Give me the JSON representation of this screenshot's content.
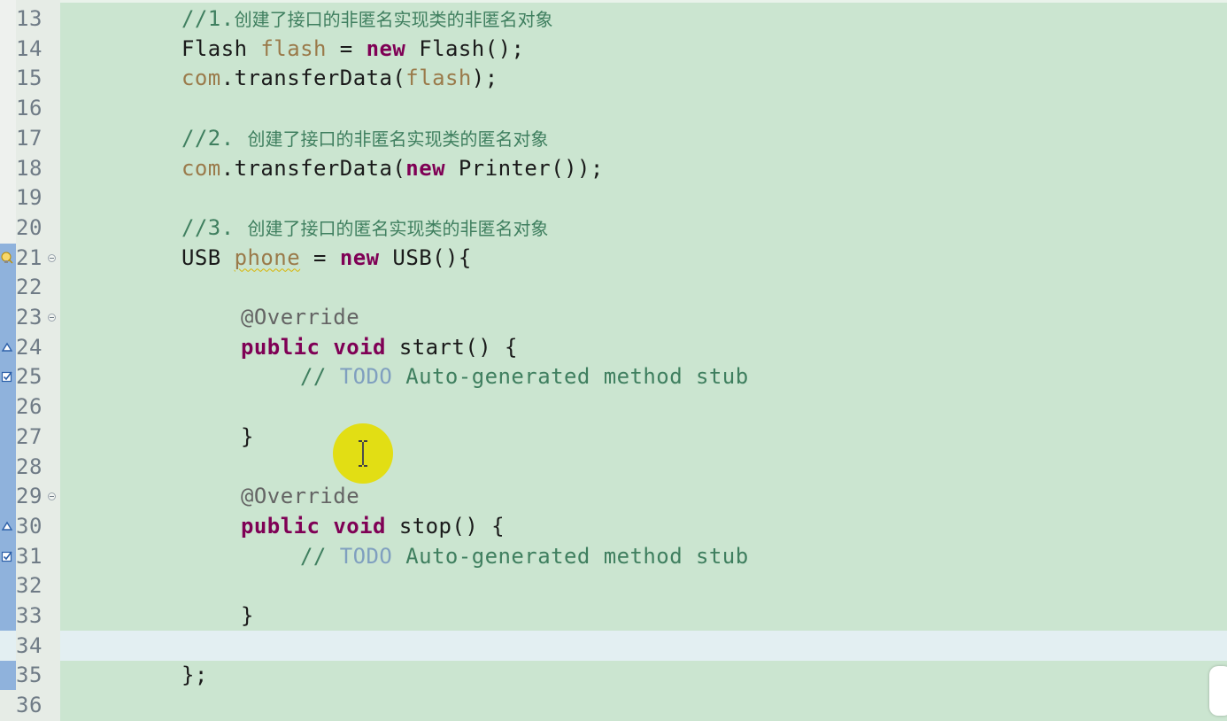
{
  "editor": {
    "lines": [
      {
        "num": "13",
        "type": "comment_zh",
        "indent": 2,
        "prefix": "//1.",
        "text": "创建了接口的非匿名实现类的非匿名对象"
      },
      {
        "num": "14",
        "type": "code",
        "indent": 2,
        "tokens": [
          {
            "t": "Flash ",
            "c": "plain"
          },
          {
            "t": "flash",
            "c": "var"
          },
          {
            "t": " = ",
            "c": "plain"
          },
          {
            "t": "new",
            "c": "kw"
          },
          {
            "t": " Flash();",
            "c": "plain"
          }
        ]
      },
      {
        "num": "15",
        "type": "code",
        "indent": 2,
        "tokens": [
          {
            "t": "com",
            "c": "var"
          },
          {
            "t": ".transferData(",
            "c": "plain"
          },
          {
            "t": "flash",
            "c": "var"
          },
          {
            "t": ");",
            "c": "plain"
          }
        ]
      },
      {
        "num": "16",
        "type": "blank"
      },
      {
        "num": "17",
        "type": "comment_zh",
        "indent": 2,
        "prefix": "//2. ",
        "text": "创建了接口的非匿名实现类的匿名对象"
      },
      {
        "num": "18",
        "type": "code",
        "indent": 2,
        "tokens": [
          {
            "t": "com",
            "c": "var"
          },
          {
            "t": ".transferData(",
            "c": "plain"
          },
          {
            "t": "new",
            "c": "kw"
          },
          {
            "t": " Printer());",
            "c": "plain"
          }
        ]
      },
      {
        "num": "19",
        "type": "blank"
      },
      {
        "num": "20",
        "type": "comment_zh",
        "indent": 2,
        "prefix": "//3. ",
        "text": "创建了接口的匿名实现类的非匿名对象"
      },
      {
        "num": "21",
        "type": "code",
        "indent": 2,
        "fold": true,
        "marker": "warning-bulb-icon",
        "tokens": [
          {
            "t": "USB ",
            "c": "plain"
          },
          {
            "t": "phone",
            "c": "var-squiggle"
          },
          {
            "t": " = ",
            "c": "plain"
          },
          {
            "t": "new",
            "c": "kw"
          },
          {
            "t": " USB(){",
            "c": "plain"
          }
        ]
      },
      {
        "num": "22",
        "type": "blank"
      },
      {
        "num": "23",
        "type": "code",
        "indent": 3,
        "fold": true,
        "tokens": [
          {
            "t": "@Override",
            "c": "ann"
          }
        ]
      },
      {
        "num": "24",
        "type": "code",
        "indent": 3,
        "marker": "override-triangle-icon",
        "tokens": [
          {
            "t": "public",
            "c": "kw"
          },
          {
            "t": " ",
            "c": "plain"
          },
          {
            "t": "void",
            "c": "kw"
          },
          {
            "t": " start() {",
            "c": "plain"
          }
        ]
      },
      {
        "num": "25",
        "type": "code",
        "indent": 4,
        "marker": "task-checkbox-icon",
        "tokens": [
          {
            "t": "// ",
            "c": "cm"
          },
          {
            "t": "TODO",
            "c": "todo"
          },
          {
            "t": " Auto-generated method stub",
            "c": "cm"
          }
        ]
      },
      {
        "num": "26",
        "type": "blank"
      },
      {
        "num": "27",
        "type": "code",
        "indent": 3,
        "tokens": [
          {
            "t": "}",
            "c": "plain"
          }
        ]
      },
      {
        "num": "28",
        "type": "blank"
      },
      {
        "num": "29",
        "type": "code",
        "indent": 3,
        "fold": true,
        "tokens": [
          {
            "t": "@Override",
            "c": "ann"
          }
        ]
      },
      {
        "num": "30",
        "type": "code",
        "indent": 3,
        "marker": "override-triangle-icon",
        "tokens": [
          {
            "t": "public",
            "c": "kw"
          },
          {
            "t": " ",
            "c": "plain"
          },
          {
            "t": "void",
            "c": "kw"
          },
          {
            "t": " stop() {",
            "c": "plain"
          }
        ]
      },
      {
        "num": "31",
        "type": "code",
        "indent": 4,
        "marker": "task-checkbox-icon",
        "tokens": [
          {
            "t": "// ",
            "c": "cm"
          },
          {
            "t": "TODO",
            "c": "todo"
          },
          {
            "t": " Auto-generated method stub",
            "c": "cm"
          }
        ]
      },
      {
        "num": "32",
        "type": "blank"
      },
      {
        "num": "33",
        "type": "code",
        "indent": 3,
        "tokens": [
          {
            "t": "}",
            "c": "plain"
          }
        ]
      },
      {
        "num": "34",
        "type": "blank",
        "current": true
      },
      {
        "num": "35",
        "type": "code",
        "indent": 2,
        "tokens": [
          {
            "t": "};",
            "c": "plain"
          }
        ]
      },
      {
        "num": "36",
        "type": "blank"
      }
    ]
  },
  "colors": {
    "background": "#cbe5d0",
    "keyword": "#7f0055",
    "comment": "#3f7f5f",
    "todo": "#7f9fbf",
    "field": "#9a7a4a",
    "annotation": "#646464",
    "current_line": "#e3eff2",
    "cursor_highlight": "#e3dd0a"
  }
}
